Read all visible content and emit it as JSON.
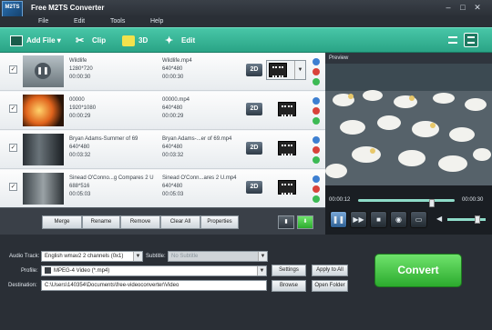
{
  "window": {
    "title": "Free M2TS Converter",
    "logo_text": "M2TS"
  },
  "menu": [
    "File",
    "Edit",
    "Tools",
    "Help"
  ],
  "toolbar": {
    "add_file": "Add File",
    "clip": "Clip",
    "three_d": "3D",
    "edit": "Edit"
  },
  "files": [
    {
      "name": "Wildlife",
      "resolution": "1280*720",
      "duration": "00:00:30",
      "out_name": "Wildlife.mp4",
      "out_resolution": "640*480",
      "out_duration": "00:00:30",
      "button": "2D"
    },
    {
      "name": "00000",
      "resolution": "1920*1080",
      "duration": "00:00:29",
      "out_name": "00000.mp4",
      "out_resolution": "640*480",
      "out_duration": "00:00:29",
      "button": "2D"
    },
    {
      "name": "Bryan Adams-Summer of 69",
      "resolution": "640*480",
      "duration": "00:03:32",
      "out_name": "Bryan Adams-...er of 69.mp4",
      "out_resolution": "640*480",
      "out_duration": "00:03:32",
      "button": "2D"
    },
    {
      "name": "Sinead O'Conno...g Compares 2 U",
      "resolution": "688*516",
      "duration": "00:05:03",
      "out_name": "Sinead O'Conn...ares 2 U.mp4",
      "out_resolution": "640*480",
      "out_duration": "00:05:03",
      "button": "2D"
    }
  ],
  "actions": {
    "merge": "Merge",
    "rename": "Rename",
    "remove": "Remove",
    "clear_all": "Clear All",
    "properties": "Properties"
  },
  "preview": {
    "label": "Preview",
    "time_current": "00:00:12",
    "time_total": "00:00:30",
    "seek_fraction": 0.4
  },
  "settings": {
    "audio_track_label": "Audio Track:",
    "audio_track_value": "English wmav2 2 channels (0x1)",
    "subtitle_label": "Subtitle:",
    "subtitle_value": "No Subtitle",
    "profile_label": "Profile:",
    "profile_value": "MPEG-4 Video (*.mp4)",
    "settings_button": "Settings",
    "apply_all_button": "Apply to All",
    "destination_label": "Destination:",
    "destination_value": "C:\\Users\\140354\\Documents\\free-videoconverter\\Video",
    "browse_button": "Browse",
    "open_folder_button": "Open Folder"
  },
  "convert_button": "Convert",
  "colors": {
    "toolbar": "#3dbf9e",
    "convert": "#43c443",
    "dark_bg": "#2a2f36"
  }
}
